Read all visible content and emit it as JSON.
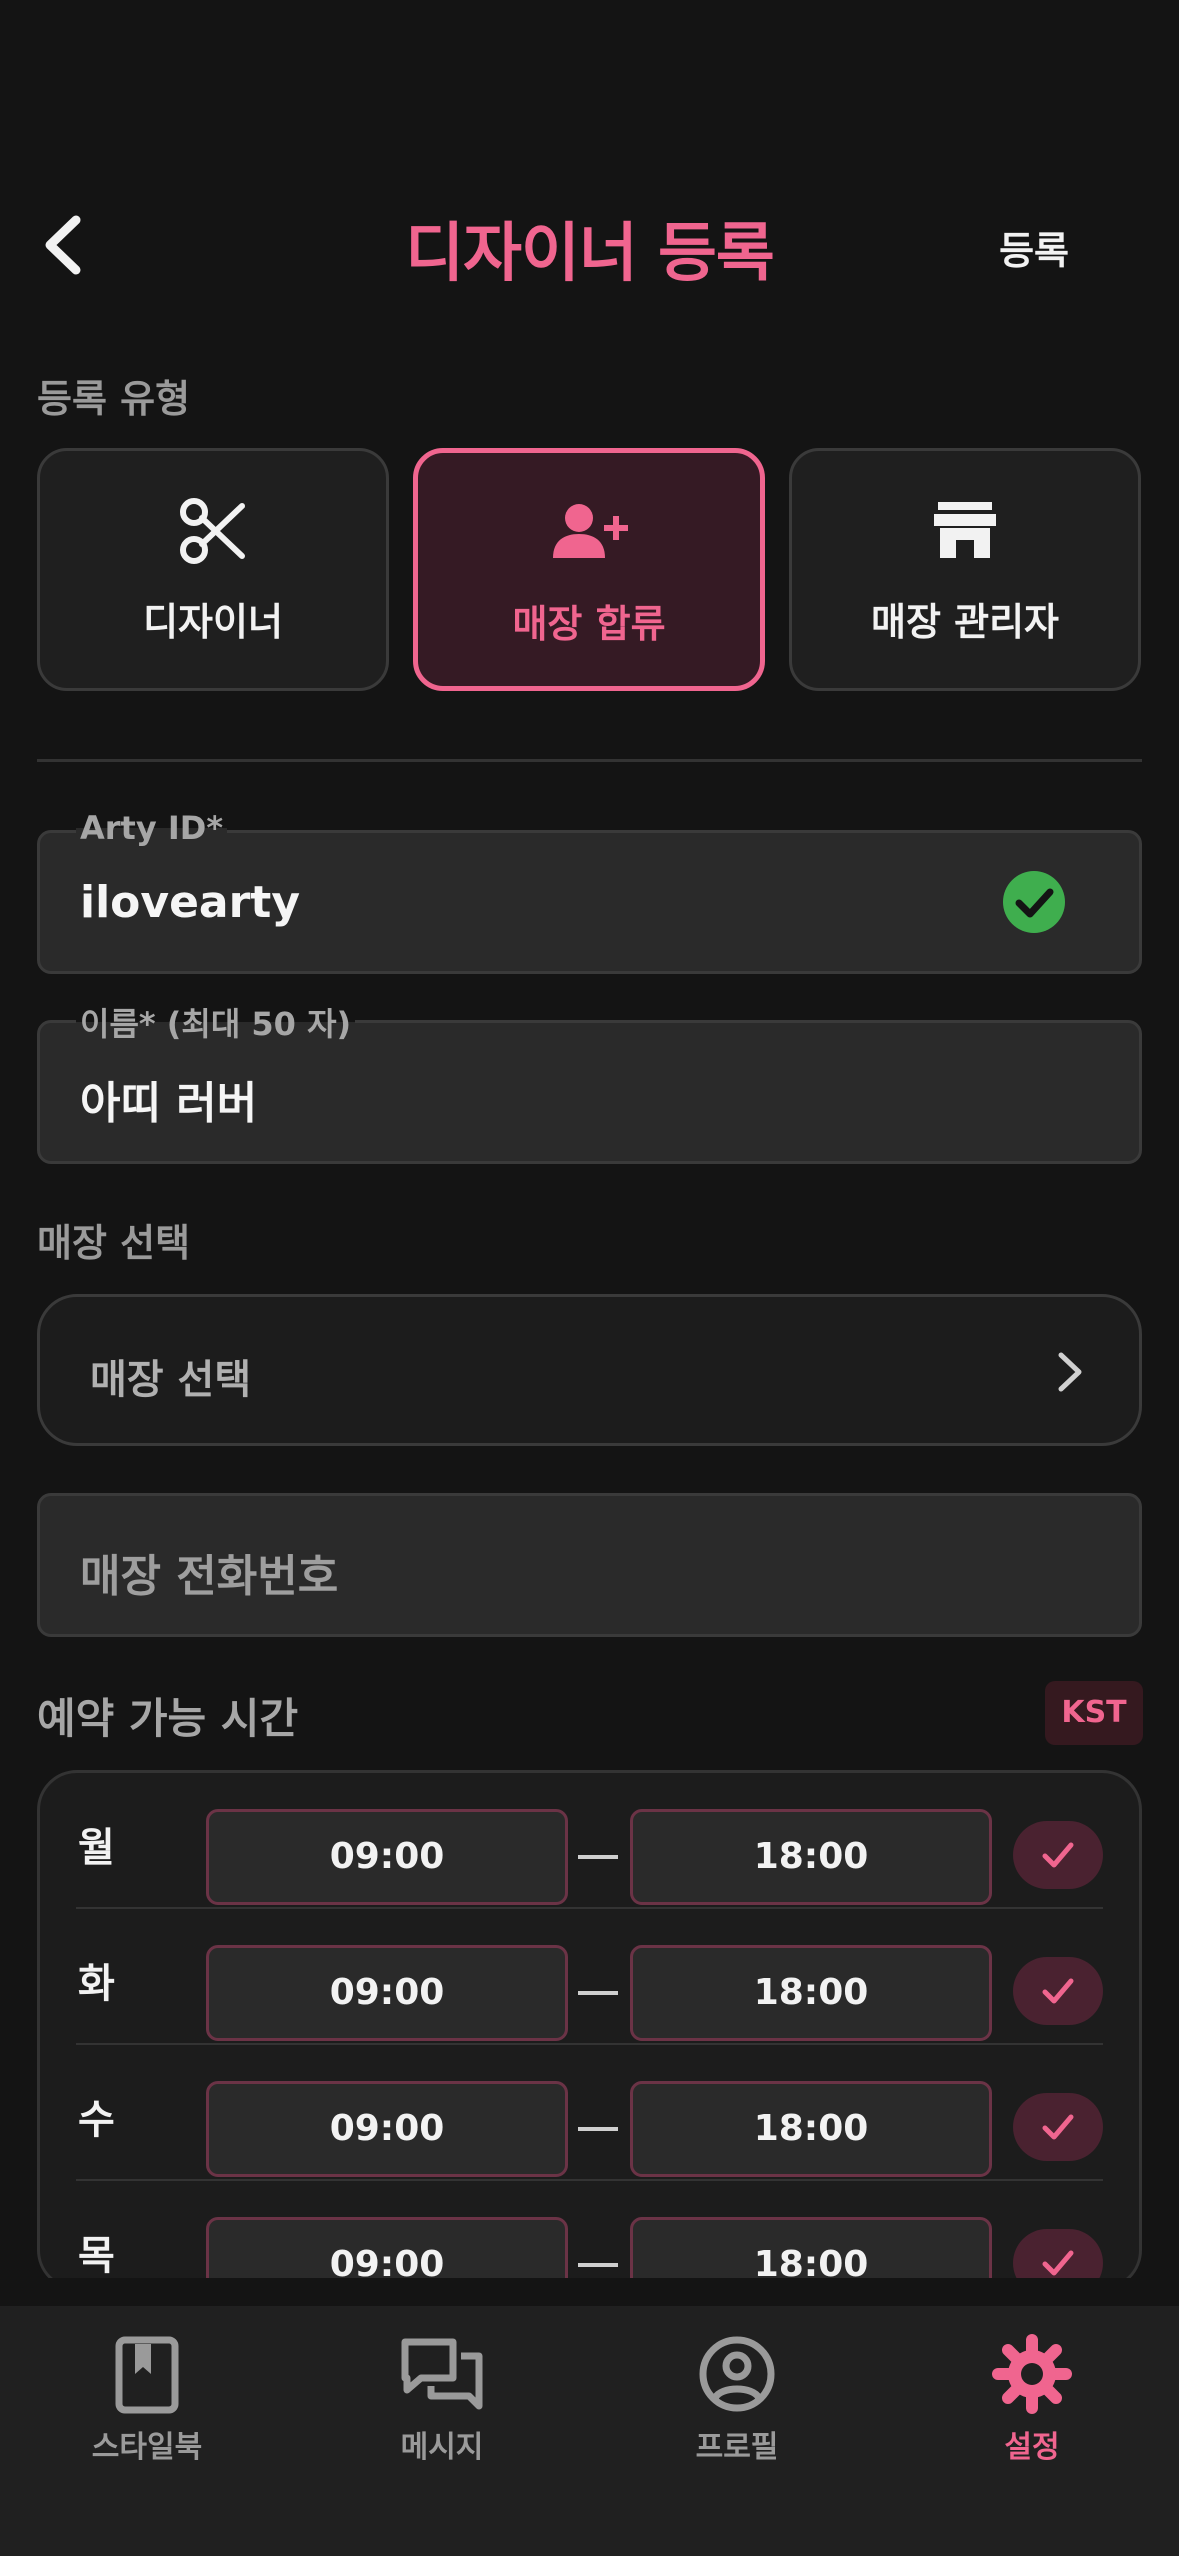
{
  "header": {
    "title": "디자이너 등록",
    "action": "등록"
  },
  "registration": {
    "label": "등록 유형",
    "types": [
      {
        "label": "디자이너",
        "icon": "scissors-icon",
        "selected": false
      },
      {
        "label": "매장 합류",
        "icon": "person-add-icon",
        "selected": true
      },
      {
        "label": "매장 관리자",
        "icon": "store-icon",
        "selected": false
      }
    ]
  },
  "fields": {
    "arty_id": {
      "label": "Arty ID*",
      "value": "ilovearty",
      "verified": true
    },
    "name": {
      "label": "이름* (최대 50 자)",
      "value": "아띠 러버"
    }
  },
  "store": {
    "section_label": "매장 선택",
    "select_text": "매장 선택",
    "phone_placeholder": "매장 전화번호"
  },
  "availability": {
    "title": "예약 가능 시간",
    "timezone": "KST",
    "days": [
      {
        "day": "월",
        "start": "09:00",
        "end": "18:00",
        "enabled": true
      },
      {
        "day": "화",
        "start": "09:00",
        "end": "18:00",
        "enabled": true
      },
      {
        "day": "수",
        "start": "09:00",
        "end": "18:00",
        "enabled": true
      },
      {
        "day": "목",
        "start": "09:00",
        "end": "18:00",
        "enabled": true
      }
    ]
  },
  "tabbar": [
    {
      "label": "스타일북",
      "icon": "stylebook-icon",
      "active": false
    },
    {
      "label": "메시지",
      "icon": "messages-icon",
      "active": false
    },
    {
      "label": "프로필",
      "icon": "profile-icon",
      "active": false
    },
    {
      "label": "설정",
      "icon": "settings-icon",
      "active": true
    }
  ],
  "colors": {
    "accent": "#f0658f",
    "background": "#141414",
    "success": "#3fae4e"
  }
}
